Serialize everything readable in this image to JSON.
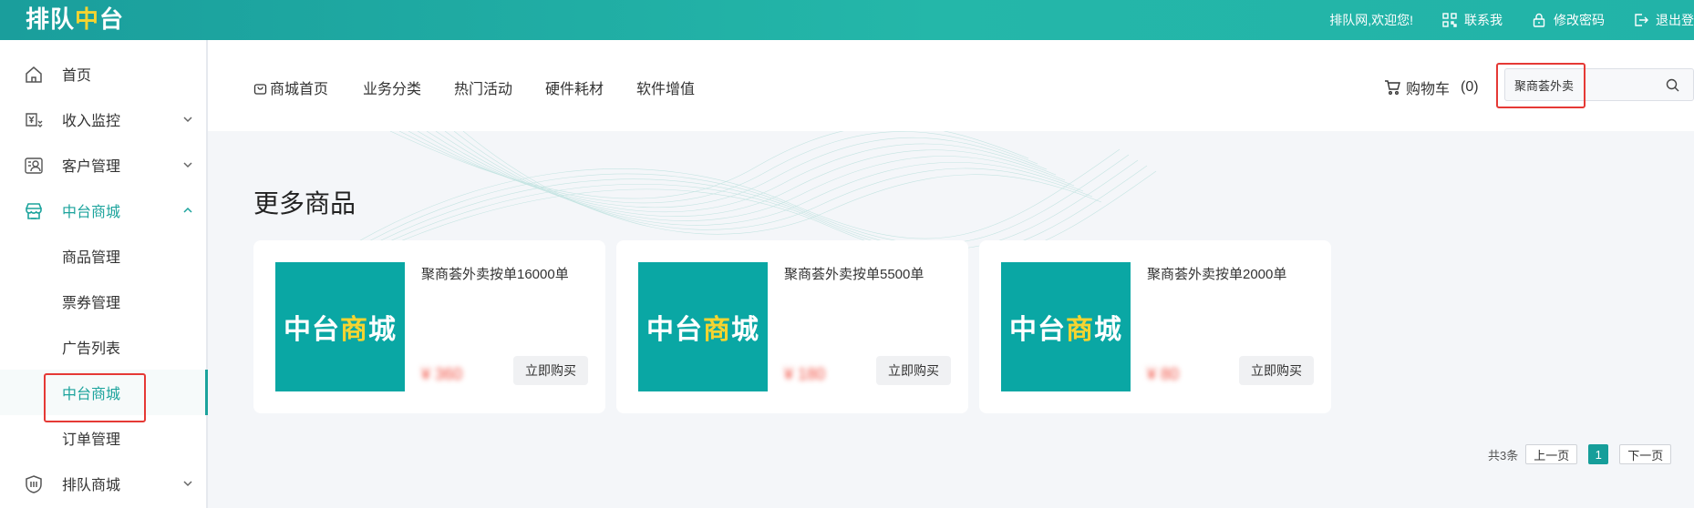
{
  "topbar": {
    "logo_part1": "排队",
    "logo_part2": "中",
    "logo_part3": "台",
    "welcome": "排队网,欢迎您!",
    "contact": "联系我",
    "change_password": "修改密码",
    "logout": "退出登"
  },
  "sidebar": {
    "items": [
      {
        "label": "首页",
        "icon": "home-icon"
      },
      {
        "label": "收入监控",
        "icon": "income-icon"
      },
      {
        "label": "客户管理",
        "icon": "customer-icon"
      },
      {
        "label": "中台商城",
        "icon": "store-icon"
      },
      {
        "label": "排队商城",
        "icon": "shield-icon"
      }
    ],
    "sub_items": [
      {
        "label": "商品管理"
      },
      {
        "label": "票券管理"
      },
      {
        "label": "广告列表"
      },
      {
        "label": "中台商城"
      },
      {
        "label": "订单管理"
      }
    ]
  },
  "mall_nav": {
    "home": "商城首页",
    "business": "业务分类",
    "hot": "热门活动",
    "hardware": "硬件耗材",
    "software": "软件增值"
  },
  "cart": {
    "label": "购物车",
    "count": "(0)"
  },
  "search": {
    "value": "聚商荟外卖"
  },
  "section_title": "更多商品",
  "products": [
    {
      "thumb1": "中台",
      "thumb2": "商",
      "thumb3": "城",
      "title": "聚商荟外卖按单16000单",
      "price": "¥ 360",
      "buy": "立即购买"
    },
    {
      "thumb1": "中台",
      "thumb2": "商",
      "thumb3": "城",
      "title": "聚商荟外卖按单5500单",
      "price": "¥ 180",
      "buy": "立即购买"
    },
    {
      "thumb1": "中台",
      "thumb2": "商",
      "thumb3": "城",
      "title": "聚商荟外卖按单2000单",
      "price": "¥ 80",
      "buy": "立即购买"
    }
  ],
  "pagination": {
    "total": "共3条",
    "prev": "上一页",
    "current": "1",
    "next": "下一页"
  },
  "colors": {
    "accent": "#1ba39c",
    "highlight_box": "#e53935",
    "price": "#f04c3e",
    "logo_yellow": "#f5d430"
  }
}
